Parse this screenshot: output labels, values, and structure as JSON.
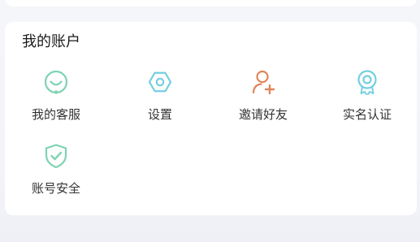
{
  "account": {
    "title": "我的账户",
    "items": [
      {
        "label": "我的客服",
        "icon": "customer-service-icon",
        "color": "#7ed3b2"
      },
      {
        "label": "设置",
        "icon": "settings-icon",
        "color": "#74cfe0"
      },
      {
        "label": "邀请好友",
        "icon": "invite-friend-icon",
        "color": "#e0865a"
      },
      {
        "label": "实名认证",
        "icon": "verification-badge-icon",
        "color": "#74cfe0"
      },
      {
        "label": "账号安全",
        "icon": "account-security-shield-icon",
        "color": "#7ed3b2"
      }
    ]
  }
}
